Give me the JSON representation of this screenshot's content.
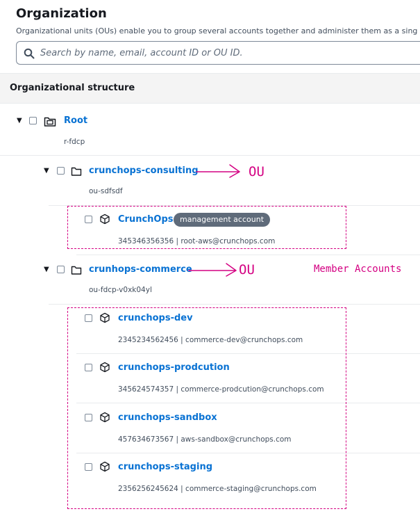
{
  "header": {
    "title": "Organization",
    "description": "Organizational units (OUs) enable you to group several accounts together and administer them as a sing"
  },
  "search": {
    "placeholder": "Search by name, email, account ID or OU ID."
  },
  "structure": {
    "heading": "Organizational structure",
    "root": {
      "name": "Root",
      "id": "r-fdcp"
    },
    "ous": [
      {
        "name": "crunchops-consulting",
        "id": "ou-sdfsdf",
        "accounts": [
          {
            "name": "CrunchOps",
            "badge": "management account",
            "details": "345346356356 | root-aws@crunchops.com"
          }
        ]
      },
      {
        "name": "crunhops-commerce",
        "id": "ou-fdcp-v0xk04yl",
        "accounts": [
          {
            "name": "crunchops-dev",
            "details": "2345234562456 | commerce-dev@crunchops.com"
          },
          {
            "name": "crunchops-prodcution",
            "details": "345624574357 | commerce-prodcution@crunchops.com"
          },
          {
            "name": "crunchops-sandbox",
            "details": "457634673567 | aws-sandbox@crunchops.com"
          },
          {
            "name": "crunchops-staging",
            "details": "2356256245624 | commerce-staging@crunchops.com"
          }
        ]
      }
    ]
  },
  "annotations": {
    "ou_label_1": "OU",
    "ou_label_2": "OU",
    "member_accounts": "Member Accounts",
    "color": "#d40082"
  },
  "colors": {
    "link": "#0972d3",
    "badge_bg": "#5f6b7a",
    "header_bg": "#f4f4f4"
  }
}
